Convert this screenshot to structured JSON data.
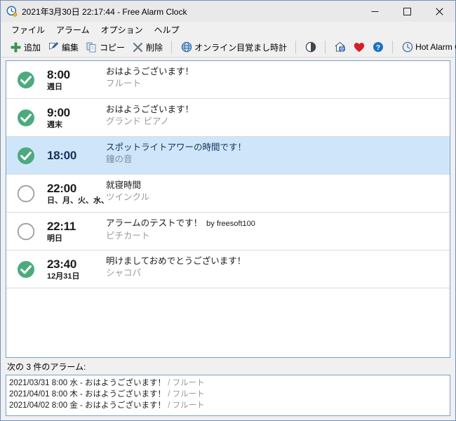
{
  "window": {
    "title": "2021年3月30日 22:17:44 - Free Alarm Clock",
    "icon": "alarm-clock-icon",
    "controls": {
      "minimize": "−",
      "maximize": "□",
      "close": "✕"
    }
  },
  "menubar": {
    "items": [
      {
        "label": "ファイル",
        "name": "menu-file"
      },
      {
        "label": "アラーム",
        "name": "menu-alarm"
      },
      {
        "label": "オプション",
        "name": "menu-options"
      },
      {
        "label": "ヘルプ",
        "name": "menu-help"
      }
    ]
  },
  "toolbar": {
    "add_label": "追加",
    "edit_label": "編集",
    "copy_label": "コピー",
    "delete_label": "削除",
    "online_label": "オンライン目覚まし時計",
    "hot_alarm_label": "Hot Alarm Clock",
    "icons": {
      "add": "plus-icon",
      "edit": "pencil-edit-icon",
      "copy": "copy-pages-icon",
      "delete": "x-delete-icon",
      "online": "globe-icon",
      "contrast": "contrast-toggle-icon",
      "home": "home-globe-icon",
      "heart": "heart-icon",
      "help": "question-help-icon",
      "hot_alarm": "clock-icon"
    },
    "colors": {
      "add_green": "#3a9a4f",
      "globe_blue": "#2a6fb5",
      "heart_red": "#d61f26",
      "help_blue": "#1a72c4"
    }
  },
  "alarm_list": {
    "selected_index": 2,
    "selected_bg": "#cfe6fa",
    "enabled_color": "#4cab7d",
    "disabled_color": "#9e9e9e",
    "rows": [
      {
        "enabled": true,
        "time": "8:00",
        "schedule": "週日",
        "title": "おはようございます！",
        "byline": "",
        "sound": "フルート"
      },
      {
        "enabled": true,
        "time": "9:00",
        "schedule": "週末",
        "title": "おはようございます！",
        "byline": "",
        "sound": "グランド ピアノ"
      },
      {
        "enabled": true,
        "time": "18:00",
        "schedule": "",
        "title": "スポットライトアワーの時間です！",
        "byline": "",
        "sound": "鐘の音"
      },
      {
        "enabled": false,
        "time": "22:00",
        "schedule": "日、月、火、水、",
        "title": "就寝時間",
        "byline": "",
        "sound": "ツインクル"
      },
      {
        "enabled": false,
        "time": "22:11",
        "schedule": "明日",
        "title": "アラームのテストです！",
        "byline": "by freesoft100",
        "sound": "ピチカート"
      },
      {
        "enabled": true,
        "time": "23:40",
        "schedule": "12月31日",
        "title": "明けましておめでとうございます！",
        "byline": "",
        "sound": "シャコパ"
      }
    ]
  },
  "next_alarms": {
    "label": "次の 3 件のアラーム:",
    "lines": [
      {
        "datetime": "2021/03/31 8:00 水 - おはようございます！",
        "sound": "/ フルート"
      },
      {
        "datetime": "2021/04/01 8:00 木 - おはようございます！",
        "sound": "/ フルート"
      },
      {
        "datetime": "2021/04/02 8:00 金 - おはようございます！",
        "sound": "/ フルート"
      }
    ]
  }
}
